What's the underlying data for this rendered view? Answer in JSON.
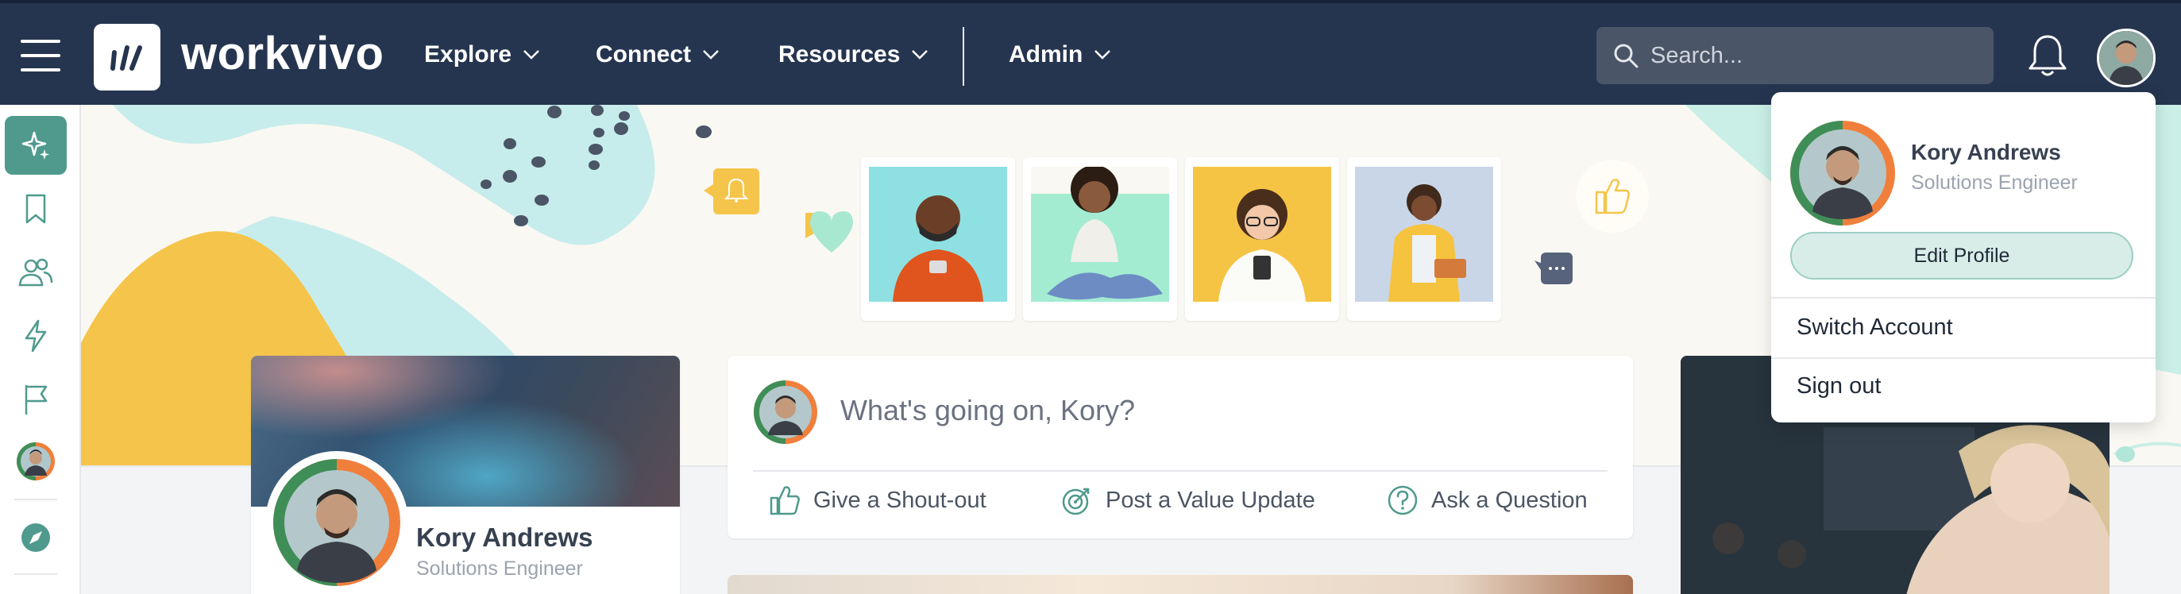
{
  "topbar": {
    "brand": "workvivo",
    "nav": [
      {
        "label": "Explore"
      },
      {
        "label": "Connect"
      },
      {
        "label": "Resources"
      },
      {
        "label": "Admin"
      }
    ],
    "search_placeholder": "Search..."
  },
  "profile_card": {
    "name": "Kory Andrews",
    "role": "Solutions Engineer"
  },
  "composer": {
    "placeholder": "What's going on, Kory?",
    "actions": [
      {
        "label": "Give a Shout-out"
      },
      {
        "label": "Post a Value Update"
      },
      {
        "label": "Ask a Question"
      }
    ]
  },
  "account_menu": {
    "name": "Kory Andrews",
    "role": "Solutions Engineer",
    "edit_profile": "Edit Profile",
    "switch_account": "Switch Account",
    "sign_out": "Sign out"
  },
  "colors": {
    "topbar": "#26354f",
    "accent": "#4f9a8d",
    "banner_mint": "#c9efe6",
    "banner_yellow": "#f5c54b"
  }
}
